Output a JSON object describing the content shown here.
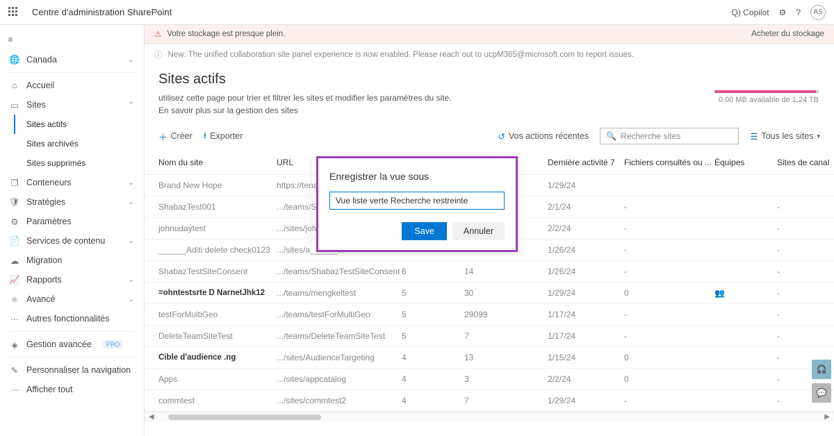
{
  "header": {
    "app_title": "Centre d'administration SharePoint",
    "copilot": "Q) Copilot",
    "avatar_initials": "AS"
  },
  "sidebar": {
    "tenant": "Canada",
    "items": [
      {
        "icon": "home",
        "label": "Accueil"
      },
      {
        "icon": "globe",
        "label": "Sites",
        "expanded": true,
        "children": [
          {
            "label": "Sites actifs",
            "active": true
          },
          {
            "label": "Sites archivés"
          },
          {
            "label": "Sites supprimés"
          }
        ]
      },
      {
        "icon": "box",
        "label": "Conteneurs",
        "chev": true
      },
      {
        "icon": "shield",
        "label": "Stratégies",
        "chev": true
      },
      {
        "icon": "gear",
        "label": "Paramètres"
      },
      {
        "icon": "doc",
        "label": "Services de contenu",
        "chev": true
      },
      {
        "icon": "cloud",
        "label": "Migration"
      },
      {
        "icon": "chart",
        "label": "Rapports",
        "chev": true
      },
      {
        "icon": "nodes",
        "label": "Avancé",
        "chev": true
      },
      {
        "icon": "",
        "label": "Autres fonctionnalités"
      }
    ],
    "advanced_mgmt": "Gestion avancée",
    "advanced_badge": "PRO",
    "customize_nav": "Personnaliser la navigation",
    "show_all": "Afficher tout"
  },
  "banners": {
    "warn_text": "Votre stockage est presque plein.",
    "buy_storage": "Acheter du stockage",
    "info_text": "New: The unified collaboration site panel experience is now enabled. Please reach out to ucpM365@microsoft.com to report issues."
  },
  "page": {
    "title": "Sites actifs",
    "subtitle": "utilisez cette page pour trier et filtrer les sites et modifier les paramètres du site.",
    "learn_more": "En savoir plus sur la gestion des sites"
  },
  "storage": {
    "text": "0,00 MB available de 1,24 TB"
  },
  "commandbar": {
    "create": "Créer",
    "export": "Exporter",
    "recent": "Vos actions récentes",
    "search_placeholder": "Recherche sites",
    "view_label": "Tous les sites"
  },
  "table": {
    "columns": [
      "Nom du site",
      "URL",
      "",
      "",
      "Dernière activité 7",
      "Fichiers consultés ou ...",
      "Équipes",
      "Sites de canal"
    ],
    "rows": [
      {
        "name": "Brand New Hope",
        "url": "https://tenantadmi...",
        "c2": "",
        "c3": "",
        "date": "1/29/24",
        "files": "",
        "teams": "",
        "chan": "",
        "bold": false
      },
      {
        "name": "ShabazTest001",
        "url": ".../teams/ShabazT...",
        "c2": "",
        "c3": "",
        "date": "2/1/24",
        "files": "-",
        "teams": "",
        "chan": "-",
        "bold": false
      },
      {
        "name": "johnudaytest",
        "url": ".../sites/johnudayte...",
        "c2": "",
        "c3": "",
        "date": "2/2/24",
        "files": "-",
        "teams": "",
        "chan": "-",
        "bold": false
      },
      {
        "name": "______Aditi delete check0123",
        "url": ".../sites/a______...",
        "c2": "",
        "c3": "",
        "date": "1/26/24",
        "files": "-",
        "teams": "",
        "chan": "-",
        "bold": false
      },
      {
        "name": "ShabazTestSiteConsent",
        "url": ".../teams/ShabazTestSiteConsent",
        "c2": "6",
        "c3": "14",
        "date": "1/26/24",
        "files": "-",
        "teams": "",
        "chan": "-",
        "bold": false
      },
      {
        "name": "=ohntestsrte D NarnetJhk12",
        "url": ".../teams/mengkeltest",
        "c2": "5",
        "c3": "30",
        "date": "1/29/24",
        "files": "0",
        "teams": "icon",
        "chan": "-",
        "bold": true
      },
      {
        "name": "testForMultiGeo",
        "url": ".../teams/testForMultiGeo",
        "c2": "5",
        "c3": "29099",
        "date": "1/17/24",
        "files": "-",
        "teams": "",
        "chan": "-",
        "bold": false
      },
      {
        "name": "DeleteTeamSiteTest",
        "url": ".../teams/DeleteTeamSiteTest",
        "c2": "5",
        "c3": "7",
        "date": "1/17/24",
        "files": "-",
        "teams": "",
        "chan": "-",
        "bold": false
      },
      {
        "name": "Cible d'audience .ng",
        "url": ".../sites/AudienceTargeting",
        "c2": "4",
        "c3": "13",
        "date": "1/15/24",
        "files": "0",
        "teams": "",
        "chan": "-",
        "bold": true
      },
      {
        "name": "Apps",
        "url": ".../sites/appcatalog",
        "c2": "4",
        "c3": "3",
        "date": "2/2/24",
        "files": "0",
        "teams": "",
        "chan": "-",
        "bold": false
      },
      {
        "name": "commtest",
        "url": ".../sites/commtest2",
        "c2": "4",
        "c3": "7",
        "date": "1/29/24",
        "files": "-",
        "teams": "",
        "chan": "-",
        "bold": false
      }
    ]
  },
  "modal": {
    "title": "Enregistrer la vue sous",
    "input_value": "Vue liste verte Recherche restreinte",
    "save": "Save",
    "cancel": "Annuler"
  }
}
